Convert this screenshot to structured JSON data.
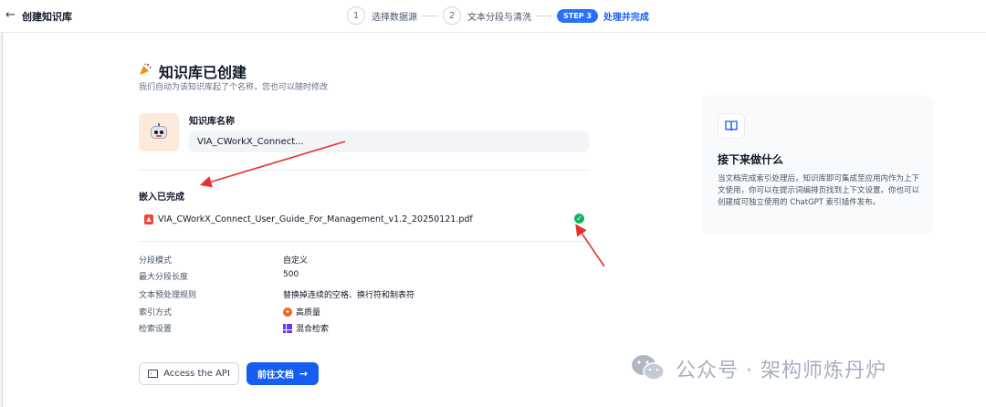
{
  "header": {
    "back_glyph": "←",
    "title": "创建知识库",
    "steps": [
      {
        "num": "1",
        "label": "选择数据源"
      },
      {
        "num": "2",
        "label": "文本分段与清洗"
      }
    ],
    "active_step": {
      "pill": "STEP 3",
      "label": "处理并完成"
    }
  },
  "main": {
    "heading_icon": "party-popper-icon",
    "heading": "知识库已创建",
    "subheading": "我们自动为该知识库起了个名称，您也可以随时修改",
    "kb_name_label": "知识库名称",
    "kb_name_value": "VIA_CWorkX_Connect...",
    "embed_title": "嵌入已完成",
    "file": {
      "name": "VIA_CWorkX_Connect_User_Guide_For_Management_v1.2_20250121.pdf",
      "status": "completed"
    },
    "props": [
      {
        "label": "分段模式",
        "value": "自定义"
      },
      {
        "label": "最大分段长度",
        "value": "500"
      },
      {
        "label": "文本预处理规则",
        "value": "替换掉连续的空格、换行符和制表符"
      },
      {
        "label": "索引方式",
        "value": "高质量",
        "icon": "high-quality-icon"
      },
      {
        "label": "检索设置",
        "value": "混合检索",
        "icon": "hybrid-search-icon"
      }
    ],
    "buttons": {
      "api": "Access the API",
      "docs": "前往文档"
    }
  },
  "side_card": {
    "icon": "book-icon",
    "title": "接下来做什么",
    "description": "当文档完成索引处理后，知识库即可集成至应用内作为上下文使用，你可以在提示词编排页找到上下文设置。你也可以创建成可独立使用的 ChatGPT 索引插件发布。"
  },
  "watermark": "公众号 · 架构师炼丹炉",
  "colors": {
    "primary": "#155eef",
    "success": "#16b364",
    "annotation_red": "#e5322d",
    "pdf_red": "#f04438"
  }
}
